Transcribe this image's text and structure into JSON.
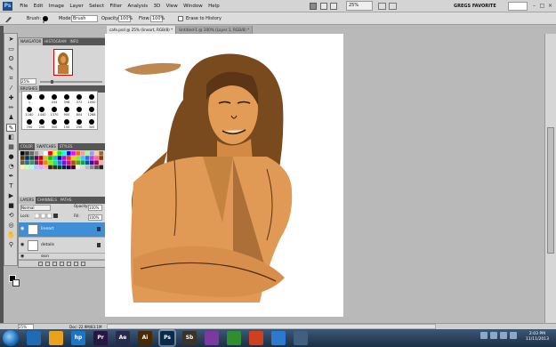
{
  "app": {
    "logo_text": "Ps",
    "accent": "#1c4f8a"
  },
  "menubar": {
    "items": [
      "File",
      "Edit",
      "Image",
      "Layer",
      "Select",
      "Filter",
      "Analysis",
      "3D",
      "View",
      "Window",
      "Help"
    ],
    "zoom": "25%",
    "workspace": "GREGS FAVORITE"
  },
  "options": {
    "brush_label": "Brush:",
    "brush_size": "8",
    "mode_label": "Mode:",
    "mode": "Brush",
    "opacity_label": "Opacity:",
    "opacity": "100%",
    "flow_label": "Flow:",
    "flow": "100%",
    "erase_label": "Erase to History"
  },
  "documents": {
    "tabs": [
      "cafe.psd @ 25% (lineart, RGB/8) *",
      "Untitled-1 @ 100% (Layer 1, RGB/8) *"
    ]
  },
  "navigator": {
    "tabs": [
      "NAVIGATOR",
      "HISTOGRAM",
      "INFO"
    ],
    "zoom": "25%"
  },
  "brushes": {
    "tab": "BRUSHES",
    "sizes": [
      "1",
      "",
      "434",
      "398",
      "372",
      "1050",
      "1160",
      "1440",
      "1370",
      "900",
      "804",
      "1268",
      "700",
      "250",
      "300",
      "150",
      "250",
      "300"
    ]
  },
  "swatches": {
    "tabs": [
      "COLOR",
      "SWATCHES",
      "STYLES"
    ],
    "colors": [
      "#000000",
      "#333333",
      "#666666",
      "#999999",
      "#cccccc",
      "#ffffff",
      "#ff0000",
      "#ffff00",
      "#00ff00",
      "#00ffff",
      "#0000ff",
      "#ff00ff",
      "#ff6600",
      "#ff9999",
      "#99ff99",
      "#9999ff",
      "#ffcc99",
      "#996633",
      "#663300",
      "#003366",
      "#006633",
      "#660066",
      "#cc0000",
      "#cccc00",
      "#00cc00",
      "#00cccc",
      "#0000cc",
      "#cc00cc",
      "#ff3300",
      "#ffcc00",
      "#66ff33",
      "#33ccff",
      "#3366ff",
      "#cc33ff",
      "#ff6699",
      "#993300",
      "#666633",
      "#336699",
      "#339966",
      "#663366",
      "#ee1111",
      "#ee8800",
      "#88ee00",
      "#00ee88",
      "#0088ee",
      "#8800ee",
      "#ee0088",
      "#aa5500",
      "#55aa00",
      "#00aa55",
      "#0055aa",
      "#5500aa",
      "#aa0055",
      "#ffaaaa",
      "#ffeeaa",
      "#ccffaa",
      "#aaffee",
      "#aaccff",
      "#ddaaff",
      "#ffaadd",
      "#442200",
      "#224400",
      "#004422",
      "#002244",
      "#220044",
      "#440022",
      "#eeeeee",
      "#dddddd",
      "#bbbbbb",
      "#888888",
      "#555555",
      "#222222"
    ]
  },
  "layers": {
    "tabs": [
      "LAYERS",
      "CHANNELS",
      "PATHS"
    ],
    "mode": "Normal",
    "opacity_label": "Opacity:",
    "opacity": "100%",
    "lock_label": "Lock:",
    "fill_label": "Fill:",
    "fill": "100%",
    "items": [
      {
        "name": "lineart",
        "selected": true
      },
      {
        "name": "details",
        "selected": false
      },
      {
        "name": "skin",
        "selected": false
      }
    ]
  },
  "status": {
    "zoom": "25%",
    "doc": "Doc: 22.9M/83.1M"
  },
  "taskbar": {
    "apps": [
      {
        "label": "",
        "color": "#1f6bb5"
      },
      {
        "label": "",
        "color": "#e8a31a"
      },
      {
        "label": "hp",
        "color": "#1976c8"
      },
      {
        "label": "Pr",
        "color": "#2a1545"
      },
      {
        "label": "Ae",
        "color": "#2a2a4d"
      },
      {
        "label": "Ai",
        "color": "#4a2a00"
      },
      {
        "label": "Ps",
        "color": "#0a2a4d"
      },
      {
        "label": "Sb",
        "color": "#3a3326"
      },
      {
        "label": "",
        "color": "#7a3aa0"
      },
      {
        "label": "",
        "color": "#2f8f2f"
      },
      {
        "label": "",
        "color": "#d04020"
      },
      {
        "label": "",
        "color": "#2a7ad0"
      },
      {
        "label": "",
        "color": "#406080"
      }
    ],
    "time": "2:03 PM",
    "date": "11/11/2013"
  }
}
